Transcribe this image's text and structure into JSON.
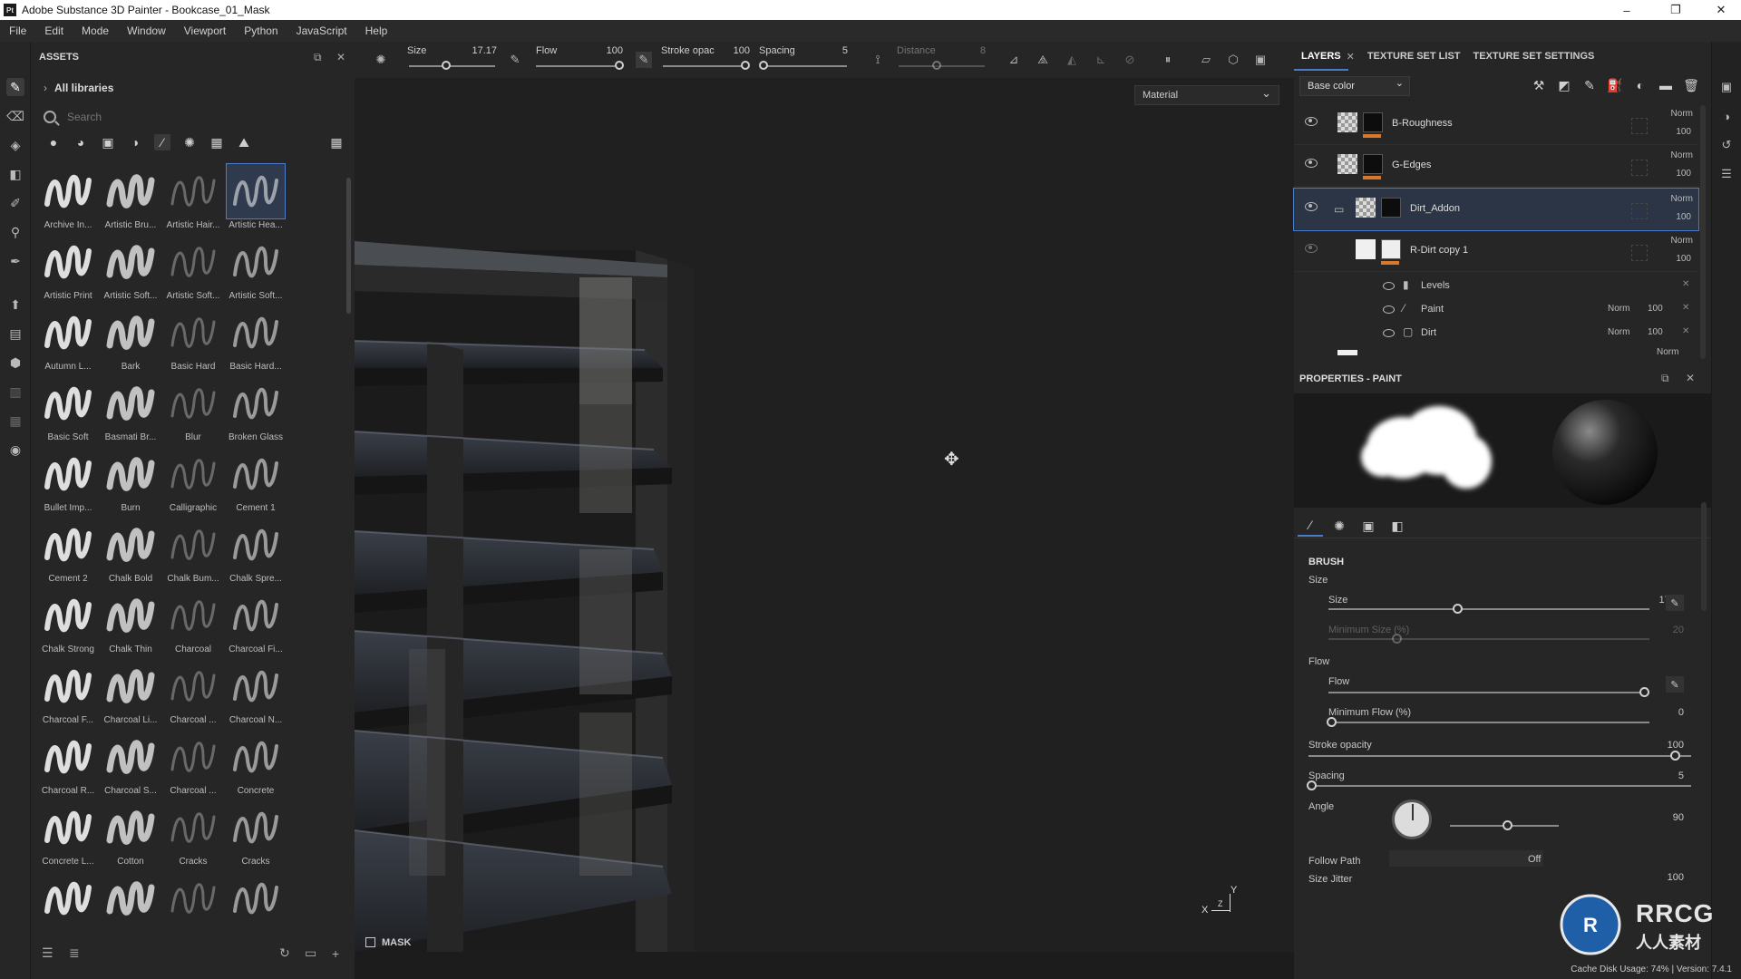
{
  "window": {
    "title": "Adobe Substance 3D Painter - Bookcase_01_Mask",
    "app_icon": "Pt"
  },
  "menu": [
    "File",
    "Edit",
    "Mode",
    "Window",
    "Viewport",
    "Python",
    "JavaScript",
    "Help"
  ],
  "assets": {
    "title": "ASSETS",
    "library": "All libraries",
    "search_placeholder": "Search",
    "brushes": [
      "Archive In...",
      "Artistic Bru...",
      "Artistic Hair...",
      "Artistic Hea...",
      "Artistic Print",
      "Artistic Soft...",
      "Artistic Soft...",
      "Artistic Soft...",
      "Autumn L...",
      "Bark",
      "Basic Hard",
      "Basic Hard...",
      "Basic Soft",
      "Basmati Br...",
      "Blur",
      "Broken Glass",
      "Bullet Imp...",
      "Burn",
      "Calligraphic",
      "Cement 1",
      "Cement 2",
      "Chalk Bold",
      "Chalk Bum...",
      "Chalk Spre...",
      "Chalk Strong",
      "Chalk Thin",
      "Charcoal",
      "Charcoal Fi...",
      "Charcoal F...",
      "Charcoal Li...",
      "Charcoal ...",
      "Charcoal N...",
      "Charcoal R...",
      "Charcoal S...",
      "Charcoal ...",
      "Concrete",
      "Concrete L...",
      "Cotton",
      "Cracks",
      "Cracks",
      "",
      "",
      "",
      ""
    ],
    "selected_index": 3
  },
  "toolbar": {
    "size_label": "Size",
    "size_value": "17.17",
    "flow_label": "Flow",
    "flow_value": "100",
    "stroke_label": "Stroke opac",
    "stroke_value": "100",
    "spacing_label": "Spacing",
    "spacing_value": "5",
    "distance_label": "Distance",
    "distance_value": "8"
  },
  "viewport": {
    "material_mode": "Material",
    "mask_label": "MASK",
    "axes": {
      "y": "Y",
      "x": "X",
      "z": "Z"
    }
  },
  "layers_panel": {
    "tabs": [
      "LAYERS",
      "TEXTURE SET LIST",
      "TEXTURE SET SETTINGS"
    ],
    "channel": "Base color",
    "layers": [
      {
        "name": "B-Roughness",
        "blend": "Norm",
        "opacity": "100"
      },
      {
        "name": "G-Edges",
        "blend": "Norm",
        "opacity": "100"
      },
      {
        "name": "Dirt_Addon",
        "blend": "Norm",
        "opacity": "100"
      },
      {
        "name": "R-Dirt copy 1",
        "blend": "Norm",
        "opacity": "100"
      }
    ],
    "effects": [
      {
        "name": "Levels",
        "blend": "",
        "opacity": ""
      },
      {
        "name": "Paint",
        "blend": "Norm",
        "opacity": "100"
      },
      {
        "name": "Dirt",
        "blend": "Norm",
        "opacity": "100"
      }
    ],
    "partial_blend": "Norm"
  },
  "properties": {
    "title": "PROPERTIES - PAINT",
    "section": "BRUSH",
    "size_group": "Size",
    "size_label": "Size",
    "size_value": "17.17",
    "size_fraction": 0.4,
    "min_size_label": "Minimum Size (%)",
    "min_size_value": "20",
    "flow_group": "Flow",
    "flow_label": "Flow",
    "flow_value": "100",
    "min_flow_label": "Minimum Flow (%)",
    "min_flow_value": "0",
    "stroke_label": "Stroke opacity",
    "stroke_value": "100",
    "spacing_label": "Spacing",
    "spacing_value": "5",
    "angle_label": "Angle",
    "angle_value": "90",
    "follow_label": "Follow Path",
    "follow_value": "Off",
    "jitter_label": "Size Jitter",
    "jitter_value": "100"
  },
  "status": {
    "text": "Cache Disk Usage:  74% | Version: 7.4.1"
  },
  "watermark": {
    "brand": "RRCG",
    "cn": "人人素材"
  },
  "colors": {
    "accent": "#4a7cc8",
    "orange": "#d7782c",
    "panel": "#262626"
  }
}
